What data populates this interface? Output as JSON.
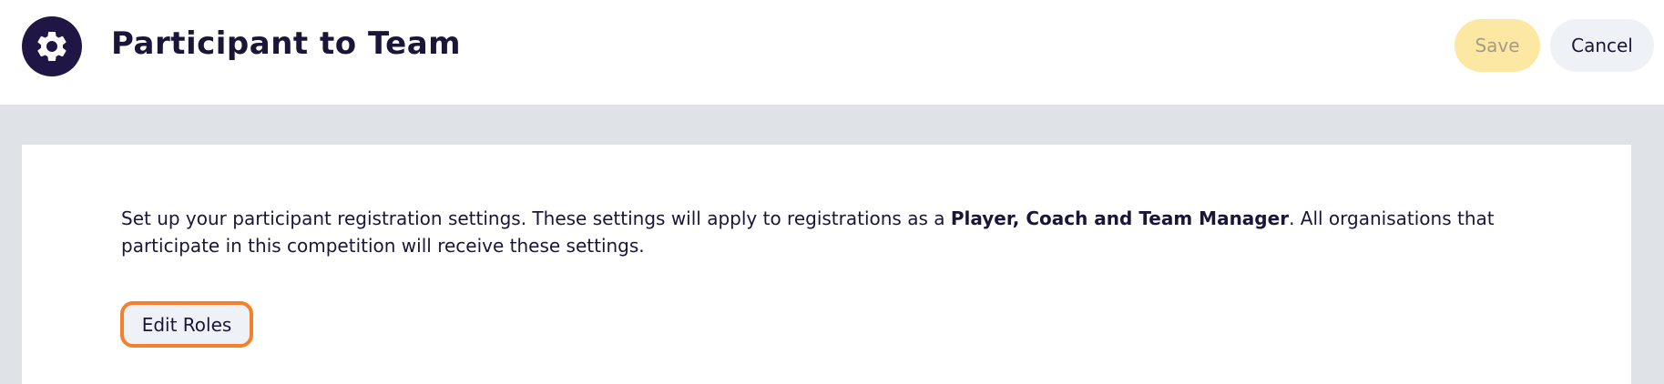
{
  "header": {
    "title": "Participant to Team",
    "logo_icon": "gear-icon",
    "save_label": "Save",
    "cancel_label": "Cancel"
  },
  "main": {
    "description_prefix": "Set up your participant registration settings. These settings will apply to registrations as a ",
    "description_bold": "Player, Coach and Team Manager",
    "description_suffix": ". All organisations that participate in this competition will receive these settings.",
    "edit_roles_label": "Edit Roles"
  },
  "colors": {
    "brand_dark": "#1f1645",
    "save_bg_disabled": "#fce7a3",
    "cancel_bg": "#eef1f6",
    "focus_ring": "#f57f2a",
    "page_bg": "#dfe3e8"
  }
}
